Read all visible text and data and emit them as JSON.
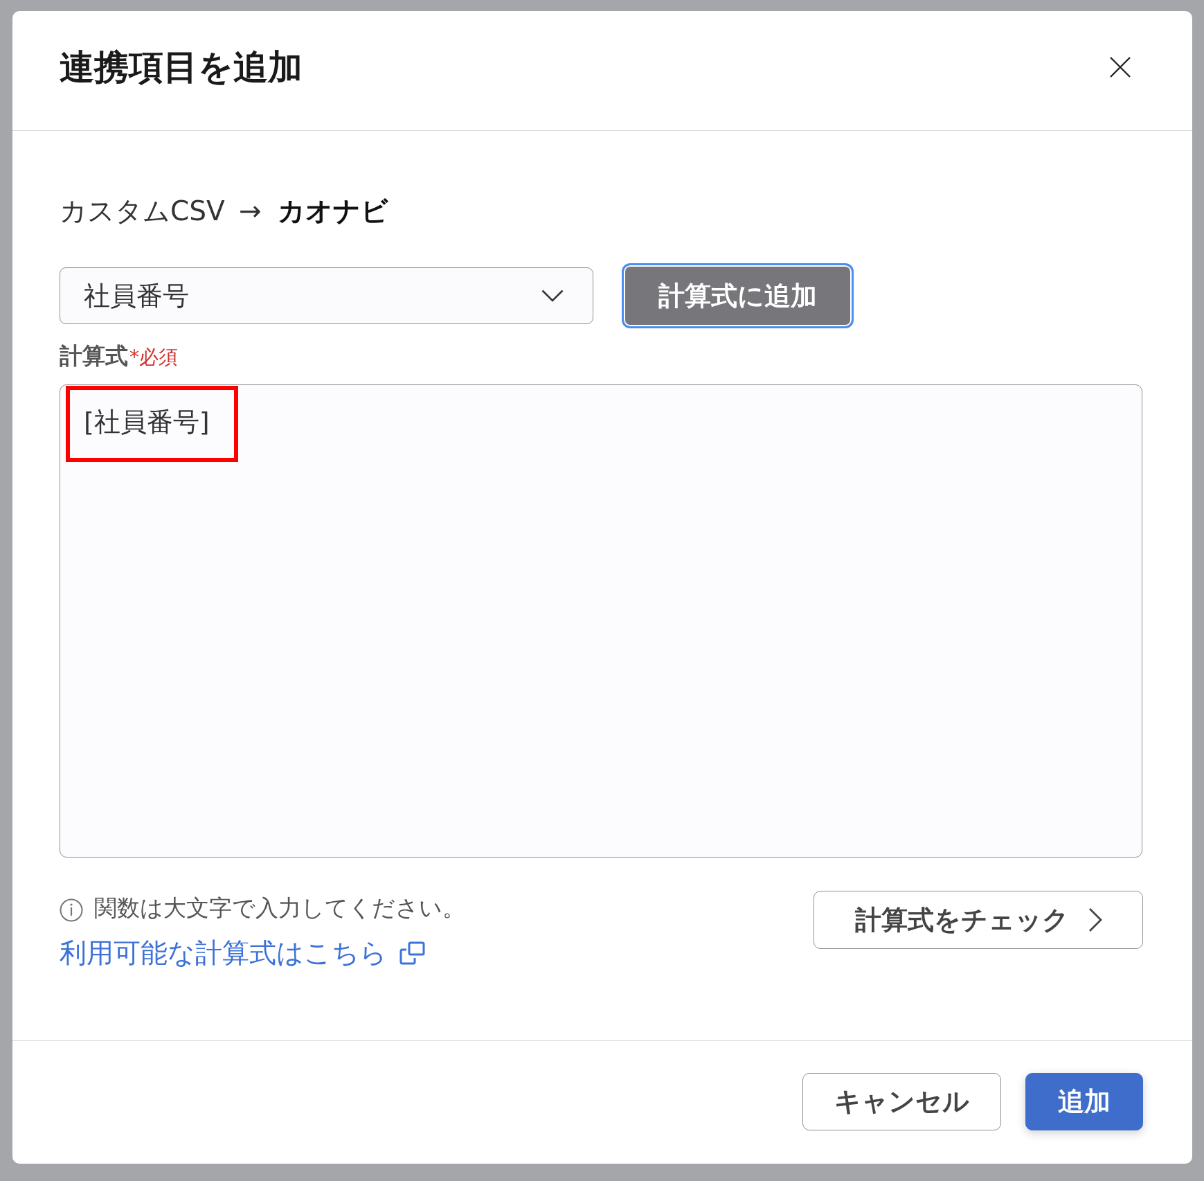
{
  "dialog": {
    "title": "連携項目を追加"
  },
  "mapping": {
    "source": "カスタムCSV",
    "arrow": "→",
    "target": "カオナビ"
  },
  "field_select": {
    "value": "社員番号"
  },
  "add_to_formula_button": {
    "label": "計算式に追加",
    "focused": true
  },
  "formula": {
    "label": "計算式",
    "required_mark": "*必須",
    "value": "[社員番号]",
    "highlighted": true
  },
  "hint": "関数は大文字で入力してください。",
  "help_link": "利用可能な計算式はこちら",
  "check_button": "計算式をチェック",
  "buttons": [
    {
      "label": "キャンセル",
      "kind": "secondary"
    },
    {
      "label": "追加",
      "kind": "primary"
    }
  ]
}
